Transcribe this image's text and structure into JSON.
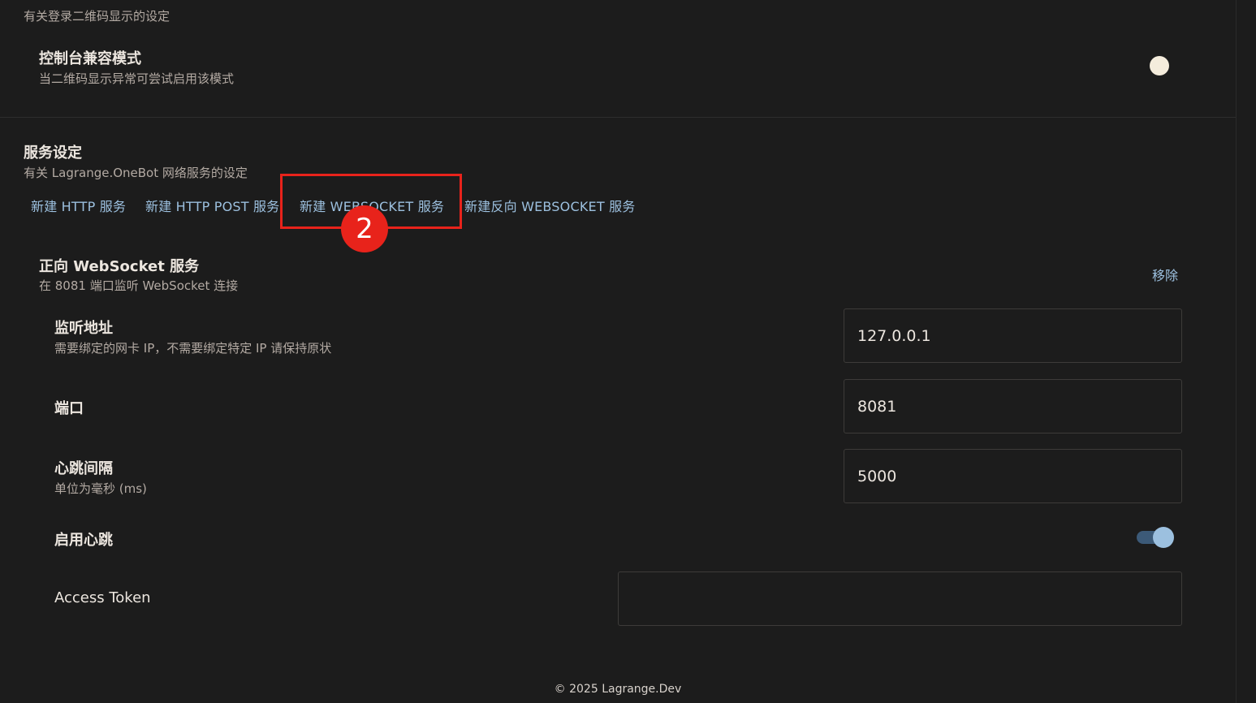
{
  "login_section": {
    "description": "有关登录二维码显示的设定",
    "compat_mode": {
      "title": "控制台兼容模式",
      "description": "当二维码显示异常可尝试启用该模式",
      "enabled": false
    }
  },
  "service_section": {
    "title": "服务设定",
    "description": "有关 Lagrange.OneBot 网络服务的设定",
    "actions": [
      {
        "label": "新建 HTTP 服务"
      },
      {
        "label": "新建 HTTP POST 服务"
      },
      {
        "label": "新建 WEBSOCKET 服务"
      },
      {
        "label": "新建反向 WEBSOCKET 服务"
      }
    ],
    "annotation": {
      "badge": "2",
      "color": "#e8231b"
    },
    "websocket_service": {
      "title": "正向 WebSocket 服务",
      "description": "在 8081 端口监听 WebSocket 连接",
      "remove_label": "移除",
      "fields": {
        "host": {
          "label": "监听地址",
          "description": "需要绑定的网卡 IP，不需要绑定特定 IP 请保持原状",
          "value": "127.0.0.1"
        },
        "port": {
          "label": "端口",
          "value": "8081"
        },
        "heartbeat_interval": {
          "label": "心跳间隔",
          "description": "单位为毫秒 (ms)",
          "value": "5000"
        },
        "heartbeat_enabled": {
          "label": "启用心跳",
          "enabled": true
        },
        "access_token": {
          "label": "Access Token",
          "value": ""
        }
      }
    }
  },
  "footer": {
    "text": "© 2025 Lagrange.Dev"
  },
  "colors": {
    "background": "#1c1c1c",
    "accent": "#9cc0df",
    "text": "#ece6df",
    "muted": "#b3aaa3",
    "annotation": "#e8231b"
  }
}
